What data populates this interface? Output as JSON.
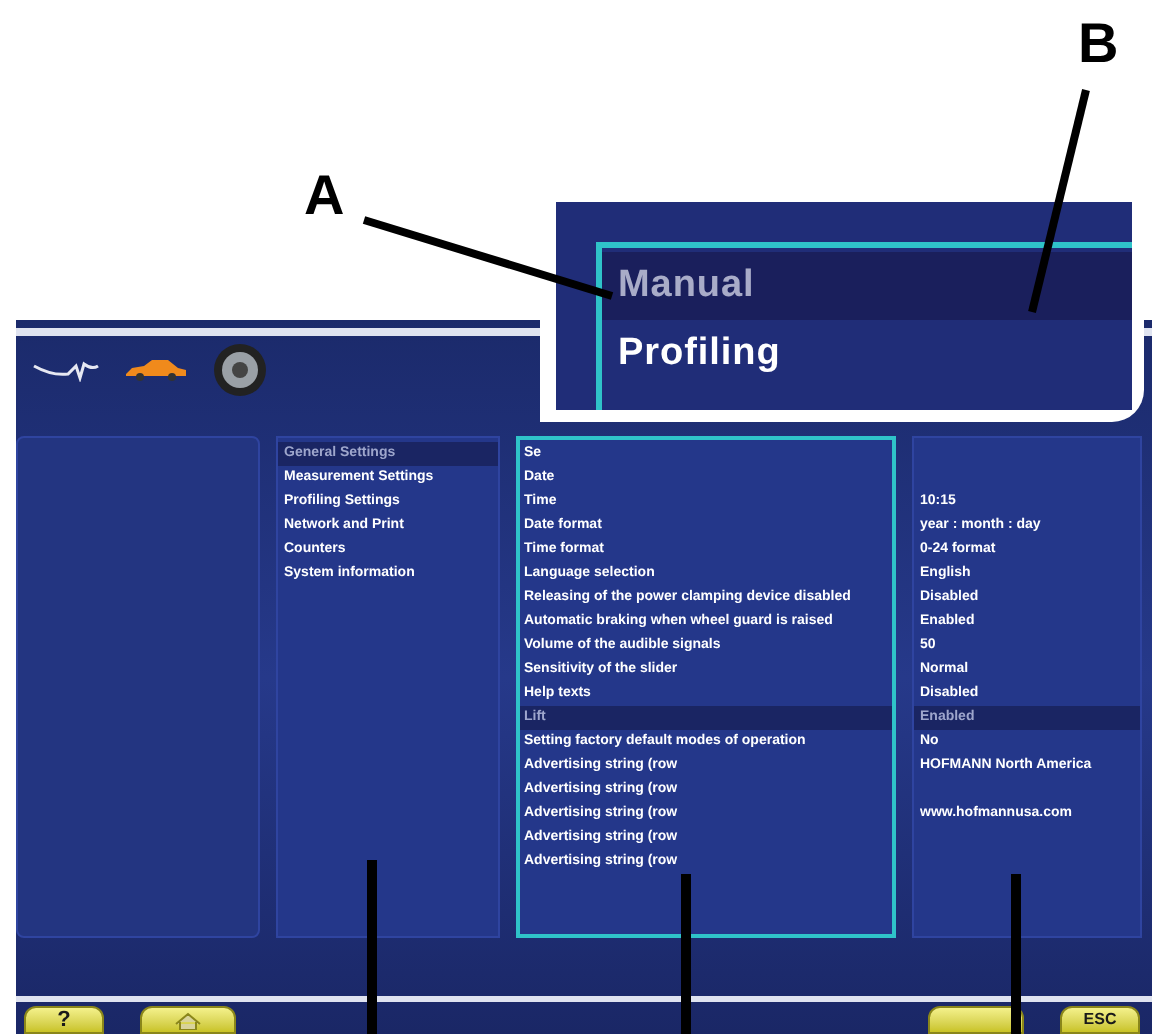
{
  "callouts": [
    {
      "label": "A"
    },
    {
      "label": "B"
    }
  ],
  "inset": {
    "items": [
      {
        "label": "Manual",
        "selected": true
      },
      {
        "label": "Profiling",
        "selected": false
      }
    ]
  },
  "categories": [
    {
      "label": "General Settings",
      "selected": true
    },
    {
      "label": "Measurement Settings",
      "selected": false
    },
    {
      "label": "Profiling Settings",
      "selected": false
    },
    {
      "label": "Network and Print",
      "selected": false
    },
    {
      "label": "Counters",
      "selected": false
    },
    {
      "label": "System information",
      "selected": false
    }
  ],
  "settings": [
    {
      "label": "Se",
      "selected": false
    },
    {
      "label": "Date",
      "selected": false
    },
    {
      "label": "Time",
      "value": "10:15",
      "selected": false
    },
    {
      "label": "Date format",
      "value": "year : month : day",
      "selected": false
    },
    {
      "label": "Time format",
      "value": "0-24 format",
      "selected": false
    },
    {
      "label": "Language selection",
      "value": "English",
      "selected": false
    },
    {
      "label": "Releasing of the power clamping device disabled",
      "value": "Disabled",
      "selected": false
    },
    {
      "label": "Automatic braking when wheel guard is raised",
      "value": "Enabled",
      "selected": false
    },
    {
      "label": "Volume of the audible signals",
      "value": "50",
      "selected": false
    },
    {
      "label": "Sensitivity of the slider",
      "value": "Normal",
      "selected": false
    },
    {
      "label": "Help texts",
      "value": "Disabled",
      "selected": false
    },
    {
      "label": "Lift",
      "value": "Enabled",
      "selected": true
    },
    {
      "label": "Setting factory default modes of operation",
      "value": "No",
      "selected": false
    },
    {
      "label": "Advertising string (row",
      "value": "HOFMANN North America",
      "selected": false
    },
    {
      "label": "Advertising string (row",
      "selected": false
    },
    {
      "label": "Advertising string (row",
      "value": "www.hofmannusa.com",
      "selected": false
    },
    {
      "label": "Advertising string (row",
      "selected": false
    },
    {
      "label": "Advertising string (row",
      "selected": false
    }
  ],
  "buttons": [
    {
      "kind": "help",
      "label": "?"
    },
    {
      "kind": "home"
    },
    {
      "kind": "blank"
    },
    {
      "kind": "text",
      "label": "ESC"
    }
  ]
}
